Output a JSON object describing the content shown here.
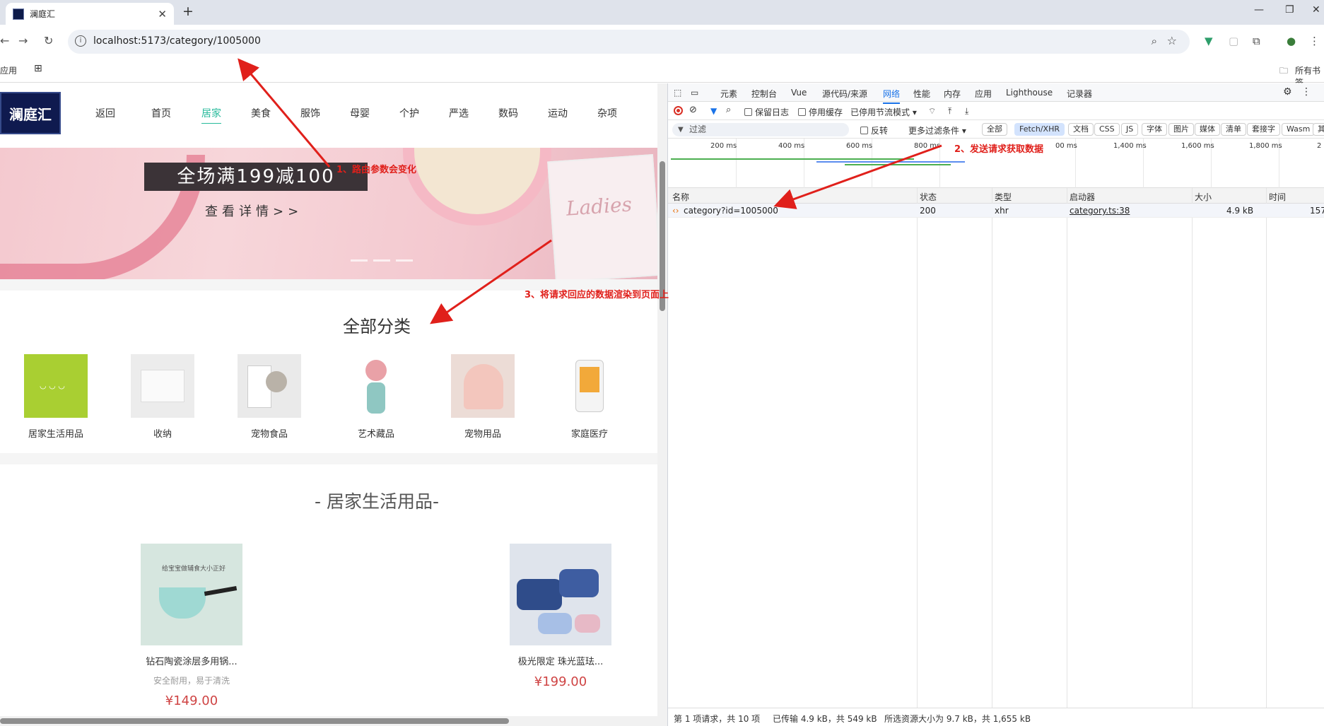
{
  "browser": {
    "tab_title": "澜庭汇",
    "url": "localhost:5173/category/1005000",
    "bookmarks": {
      "apps": "应用",
      "all_bookmarks": "所有书签"
    }
  },
  "site": {
    "logo_text": "澜庭汇",
    "nav": [
      "返回",
      "首页",
      "居家",
      "美食",
      "服饰",
      "母婴",
      "个护",
      "严选",
      "数码",
      "运动",
      "杂项"
    ],
    "active_nav": "居家",
    "banner": {
      "promo": "全场满199减100",
      "sub": "查看详情>>",
      "box_text": "Ladies"
    },
    "all_categories_title": "全部分类",
    "categories": [
      "居家生活用品",
      "收纳",
      "宠物食品",
      "艺术藏品",
      "宠物用品",
      "家庭医疗"
    ],
    "sub_title": "- 居家生活用品-",
    "products": [
      {
        "name": "钻石陶瓷涂层多用锅...",
        "desc": "安全耐用，易于清洗",
        "price": "¥149.00",
        "img_text": "给宝宝做辅食大小正好"
      },
      {
        "name": "极光限定 珠光蓝珐...",
        "desc": "",
        "price": "¥199.00",
        "img_text": ""
      }
    ]
  },
  "devtools": {
    "tabs": [
      "元素",
      "控制台",
      "Vue",
      "源代码/来源",
      "网络",
      "性能",
      "内存",
      "应用",
      "Lighthouse",
      "记录器"
    ],
    "active_tab": "网络",
    "toolbar": {
      "preserve_log": "保留日志",
      "disable_cache": "停用缓存",
      "throttle": "已停用节流模式"
    },
    "filter": {
      "placeholder": "过滤",
      "invert": "反转",
      "more": "更多过滤条件",
      "chips": [
        "全部",
        "Fetch/XHR",
        "文档",
        "CSS",
        "JS",
        "字体",
        "图片",
        "媒体",
        "清单",
        "套接字",
        "Wasm",
        "其"
      ],
      "selected_chip": "Fetch/XHR"
    },
    "timeline_ticks": [
      "200 ms",
      "400 ms",
      "600 ms",
      "800 ms",
      "00 ms",
      "1,400 ms",
      "1,600 ms",
      "1,800 ms",
      "2"
    ],
    "columns": [
      "名称",
      "状态",
      "类型",
      "启动器",
      "大小",
      "时间"
    ],
    "rows": [
      {
        "name": "category?id=1005000",
        "status": "200",
        "type": "xhr",
        "initiator": "category.ts:38",
        "size": "4.9 kB",
        "time": "157"
      }
    ],
    "status_bar": {
      "requests": "第 1 项请求，共 10 项",
      "transferred": "已传输 4.9 kB，共 549 kB",
      "resources": "所选资源大小为 9.7 kB，共 1,655 kB"
    }
  },
  "annotations": {
    "a1": "1、路由参数会变化",
    "a2": "2、发送请求获取数据",
    "a3": "3、将请求回应的数据渲染到页面上"
  },
  "colors": {
    "accent": "#27ba9b",
    "annotation": "#e0201b",
    "price": "#cf4444"
  }
}
